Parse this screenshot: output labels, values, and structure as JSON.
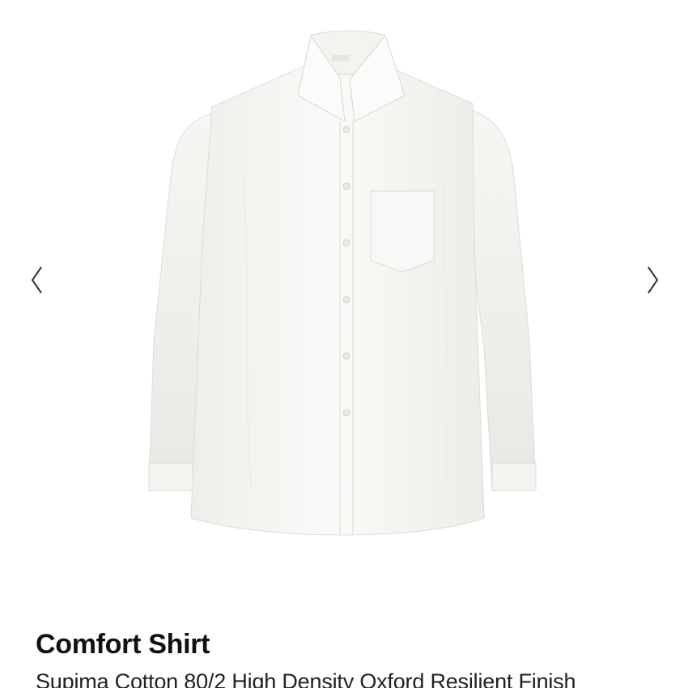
{
  "gallery": {
    "image_alt": "white shirt",
    "prev_icon": "chevron-left-icon",
    "next_icon": "chevron-right-icon"
  },
  "product": {
    "title": "Comfort Shirt",
    "subtitle": "Supima Cotton 80/2 High Density Oxford Resilient Finish"
  },
  "colors": {
    "background": "#ffffff",
    "title_text": "#111111",
    "subtitle_text": "#222222",
    "arrow": "#333333",
    "shirt": "#f7f7f5"
  }
}
